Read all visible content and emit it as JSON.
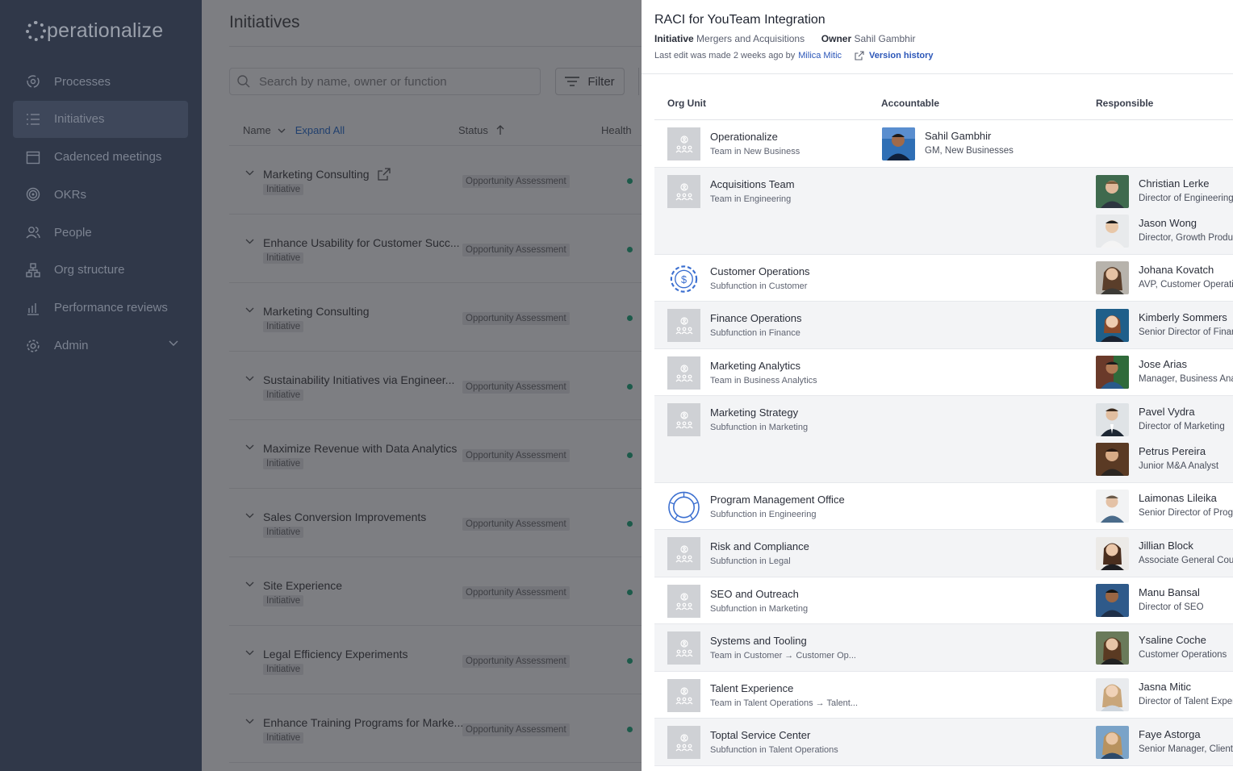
{
  "app": {
    "logo_text": "perationalize"
  },
  "sidebar": {
    "items": [
      {
        "label": "Processes",
        "icon": "processes-icon"
      },
      {
        "label": "Initiatives",
        "icon": "list-icon",
        "active": true
      },
      {
        "label": "Cadenced meetings",
        "icon": "calendar-icon"
      },
      {
        "label": "OKRs",
        "icon": "target-icon"
      },
      {
        "label": "People",
        "icon": "people-icon"
      },
      {
        "label": "Org structure",
        "icon": "org-structure-icon"
      },
      {
        "label": "Performance reviews",
        "icon": "bar-chart-icon"
      },
      {
        "label": "Admin",
        "icon": "gear-icon"
      }
    ]
  },
  "main": {
    "title": "Initiatives",
    "search_placeholder": "Search by name, owner or function",
    "filter_label": "Filter",
    "columns": {
      "name": "Name",
      "expand_all": "Expand All",
      "status": "Status",
      "health": "Health"
    },
    "rows": [
      {
        "name": "Marketing Consulting",
        "tag": "Initiative",
        "status": "Opportunity Assessment",
        "external": true
      },
      {
        "name": "Enhance Usability for Customer Succ...",
        "tag": "Initiative",
        "status": "Opportunity Assessment"
      },
      {
        "name": "Marketing Consulting",
        "tag": "Initiative",
        "status": "Opportunity Assessment"
      },
      {
        "name": "Sustainability Initiatives via Engineer...",
        "tag": "Initiative",
        "status": "Opportunity Assessment"
      },
      {
        "name": "Maximize Revenue with Data Analytics",
        "tag": "Initiative",
        "status": "Opportunity Assessment"
      },
      {
        "name": "Sales Conversion Improvements",
        "tag": "Initiative",
        "status": "Opportunity Assessment"
      },
      {
        "name": "Site Experience",
        "tag": "Initiative",
        "status": "Opportunity Assessment"
      },
      {
        "name": "Legal Efficiency Experiments",
        "tag": "Initiative",
        "status": "Opportunity Assessment"
      },
      {
        "name": "Enhance Training Programs for Marke...",
        "tag": "Initiative",
        "status": "Opportunity Assessment"
      }
    ],
    "health_color": "#1c5a4a"
  },
  "panel": {
    "title": "RACI for YouTeam Integration",
    "initiative_label": "Initiative",
    "initiative_value": "Mergers and Acquisitions",
    "owner_label": "Owner",
    "owner_value": "Sahil Gambhir",
    "edit_text": "Last edit was made 2 weeks ago by",
    "edit_user": "Milica Mitic",
    "version_history": "Version history",
    "columns": {
      "org_unit": "Org Unit",
      "accountable": "Accountable",
      "responsible": "Responsible"
    },
    "rows": [
      {
        "org": "Operationalize",
        "sub": "Team in New Business",
        "icon": "team-icon",
        "accountable": [
          {
            "name": "Sahil Gambhir",
            "title": "GM, New Businesses"
          }
        ],
        "responsible": []
      },
      {
        "org": "Acquisitions Team",
        "sub": "Team in Engineering",
        "icon": "team-icon",
        "accountable": [],
        "responsible": [
          {
            "name": "Christian Lerke",
            "title": "Director of Engineering"
          },
          {
            "name": "Jason Wong",
            "title": "Director, Growth Product"
          }
        ]
      },
      {
        "org": "Customer Operations",
        "sub": "Subfunction in Customer",
        "icon": "gear-dollar-icon",
        "accountable": [],
        "responsible": [
          {
            "name": "Johana Kovatch",
            "title": "AVP, Customer Operations"
          }
        ]
      },
      {
        "org": "Finance Operations",
        "sub": "Subfunction in Finance",
        "icon": "team-icon",
        "accountable": [],
        "responsible": [
          {
            "name": "Kimberly Sommers",
            "title": "Senior Director of Finance"
          }
        ]
      },
      {
        "org": "Marketing Analytics",
        "sub": "Team in Business Analytics",
        "icon": "team-icon",
        "accountable": [],
        "responsible": [
          {
            "name": "Jose Arias",
            "title": "Manager, Business Analytics"
          }
        ]
      },
      {
        "org": "Marketing Strategy",
        "sub": "Subfunction in Marketing",
        "icon": "team-icon",
        "accountable": [],
        "responsible": [
          {
            "name": "Pavel Vydra",
            "title": "Director of Marketing"
          },
          {
            "name": "Petrus Pereira",
            "title": "Junior M&A Analyst"
          }
        ]
      },
      {
        "org": "Program Management Office",
        "sub": "Subfunction in Engineering",
        "icon": "ring-icon",
        "accountable": [],
        "responsible": [
          {
            "name": "Laimonas Lileika",
            "title": "Senior Director of Programs"
          }
        ]
      },
      {
        "org": "Risk and Compliance",
        "sub": "Subfunction in Legal",
        "icon": "team-icon",
        "accountable": [],
        "responsible": [
          {
            "name": "Jillian Block",
            "title": "Associate General Counsel"
          }
        ]
      },
      {
        "org": "SEO and Outreach",
        "sub": "Subfunction in Marketing",
        "icon": "team-icon",
        "accountable": [],
        "responsible": [
          {
            "name": "Manu Bansal",
            "title": "Director of SEO"
          }
        ]
      },
      {
        "org": "Systems and Tooling",
        "sub": "Team in Customer → Customer Op...",
        "icon": "team-icon",
        "accountable": [],
        "responsible": [
          {
            "name": "Ysaline Coche",
            "title": "Customer Operations"
          }
        ]
      },
      {
        "org": "Talent Experience",
        "sub": "Team in Talent Operations → Talent...",
        "icon": "team-icon",
        "accountable": [],
        "responsible": [
          {
            "name": "Jasna Mitic",
            "title": "Director of Talent Experience"
          }
        ]
      },
      {
        "org": "Toptal Service Center",
        "sub": "Subfunction in Talent Operations",
        "icon": "team-icon",
        "accountable": [],
        "responsible": [
          {
            "name": "Faye Astorga",
            "title": "Senior Manager, Client"
          }
        ]
      }
    ]
  },
  "colors": {
    "sidebar_bg": "#303849",
    "link": "#2b56b8",
    "row_alt": "#f3f4f6",
    "overlay": "#7d7e82"
  }
}
